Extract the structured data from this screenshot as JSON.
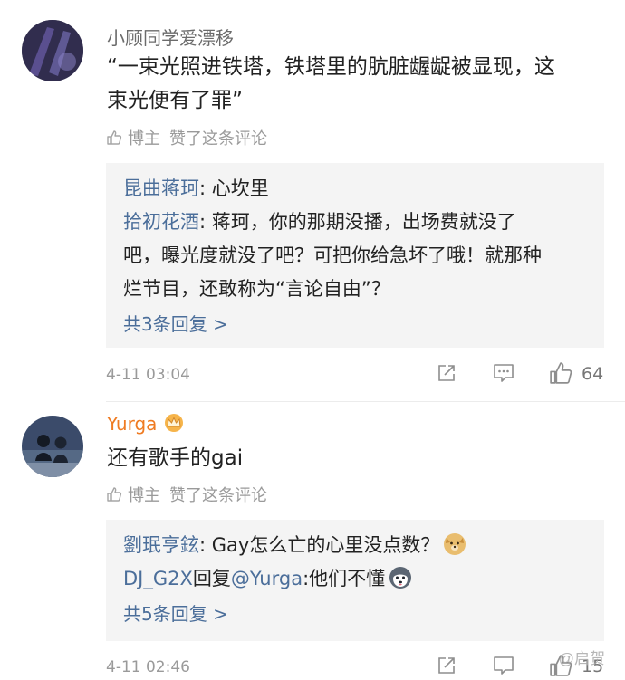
{
  "comments": [
    {
      "username": "小顾同学爱漂移",
      "text_line1": "“一束光照进铁塔，铁塔里的肮脏龌龊被显现，这",
      "text_line2": "束光便有了罪”",
      "author_like_label": "博主",
      "author_like_text": "赞了这条评论",
      "replies": [
        {
          "user": "昆曲蒋珂",
          "text": ": 心坎里"
        },
        {
          "user": "拾初花酒",
          "text": ": 蒋珂，你的那期没播，出场费就没了",
          "text2": "吧，曝光度就没了吧？可把你给急坏了哦！就那种",
          "text3": "烂节目，还敢称为“言论自由”？"
        }
      ],
      "more_replies": "共3条回复 >",
      "time": "4-11 03:04",
      "like_count": "64"
    },
    {
      "username": "Yurga",
      "text": "还有歌手的gai",
      "author_like_label": "博主",
      "author_like_text": "赞了这条评论",
      "replies": [
        {
          "user": "劉珉亨鉉",
          "text": ": Gay怎么亡的心里没点数？"
        },
        {
          "user": "DJ_G2X",
          "text": "回复",
          "mention": "@Yurga",
          "text_after": ":他们不懂"
        }
      ],
      "more_replies": "共5条回复 >",
      "time": "4-11 02:46",
      "like_count": "15"
    }
  ],
  "watermark": "@启贺",
  "colors": {
    "link": "#4b6e9a",
    "vip_name": "#ef7b22",
    "meta": "#9a9a9a",
    "reply_bg": "#f4f4f4"
  }
}
